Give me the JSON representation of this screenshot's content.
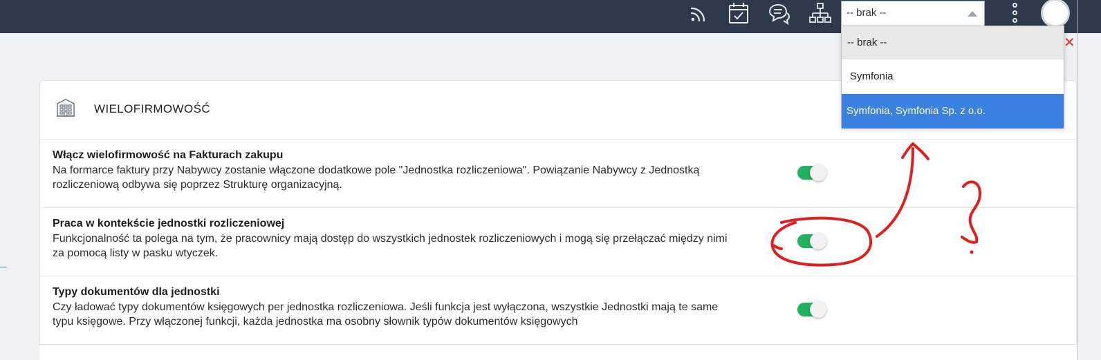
{
  "topbar": {
    "icons": [
      "rss-icon",
      "calendar-check-icon",
      "chat-icon",
      "org-chart-icon"
    ],
    "company_select": {
      "value": "-- brak --"
    }
  },
  "dropdown": {
    "options": [
      "-- brak --",
      "Symfonia",
      "Symfonia, Symfonia Sp. z o.o."
    ],
    "selected_index": 2
  },
  "card": {
    "title": "WIELOFIRMOWOŚĆ",
    "settings": [
      {
        "title": "Włącz wielofirmowość na Fakturach zakupu",
        "desc_line1": "Na formarce faktury przy Nabywcy zostanie włączone dodatkowe pole \"Jednostka rozliczeniowa\". Powiązanie Nabywcy z Jednostką",
        "desc_line2": "rozliczeniową odbywa się poprzez Strukturę organizacyjną.",
        "enabled": true
      },
      {
        "title": "Praca w kontekście jednostki rozliczeniowej",
        "desc_line1": "Funkcjonalność ta polega na tym, że pracownicy mają dostęp do wszystkich jednostek rozliczeniowych i mogą się przełączać między nimi",
        "desc_line2": "za pomocą listy w pasku wtyczek.",
        "enabled": true
      },
      {
        "title": "Typy dokumentów dla jednostki",
        "desc_line1": "Czy ładować typy dokumentów księgowych per jednostka rozliczeniowa. Jeśli funkcja jest wyłączona, wszystkie Jednostki mają te same",
        "desc_line2": "typu księgowe. Przy włączonej funkcji, każda jednostka ma osobny słownik typów dokumentów księgowych",
        "enabled": true
      }
    ]
  },
  "colors": {
    "topbar": "#2c3a4b",
    "toggle_on": "#21b15f",
    "selected_option": "#3b82e0",
    "annotation": "#e02020"
  }
}
